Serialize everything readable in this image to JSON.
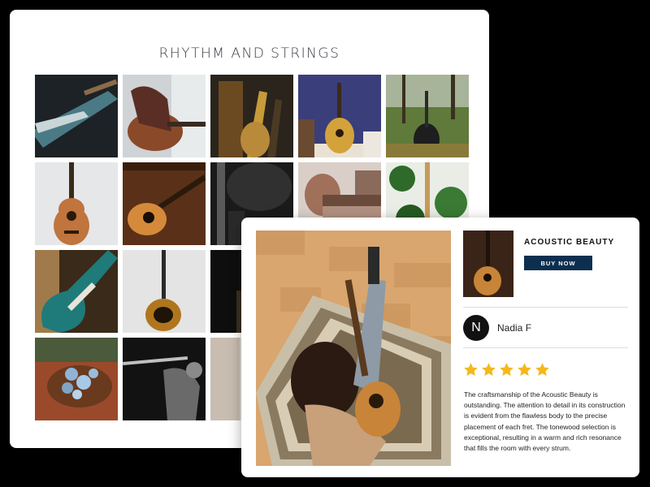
{
  "gallery": {
    "title": "RHYTHM AND STRINGS",
    "tiles": [
      "electric-guitar-closeup",
      "person-playing-guitar",
      "guitars-on-stands",
      "acoustic-guitar-blue-wall",
      "guitar-in-garden",
      "ukulele",
      "acoustic-guitar-wood-bg",
      "guitar-dark-smoke",
      "hands-playing-guitar",
      "guitar-plants",
      "teal-electric-guitar",
      "hollow-body-guitar",
      "dark-guitar",
      "",
      "",
      "flowers-on-guitar",
      "flute-player",
      "partial-tile",
      "",
      ""
    ]
  },
  "review": {
    "product_name": "ACOUSTIC BEAUTY",
    "buy_label": "BUY NOW",
    "avatar_letter": "N",
    "reviewer_name": "Nadia F",
    "rating": 5,
    "rating_max": 5,
    "star_color": "#f5b81c",
    "text": "The craftsmanship of the Acoustic Beauty is outstanding. The attention to detail in its construction is evident from the flawless body to the precise placement of each fret. The tonewood selection is exceptional, resulting in a warm and rich resonance that fills the room with every strum."
  },
  "colors": {
    "buy_button": "#0d2f4f",
    "title_text": "#3a3d45"
  }
}
